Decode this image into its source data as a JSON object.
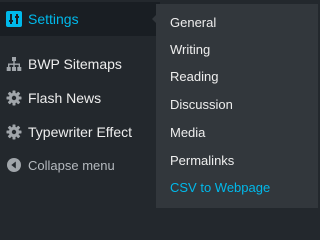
{
  "menu": {
    "settings": "Settings",
    "bwp_sitemaps": "BWP Sitemaps",
    "flash_news": "Flash News",
    "typewriter_effect": "Typewriter Effect",
    "collapse": "Collapse menu"
  },
  "submenu": [
    "General",
    "Writing",
    "Reading",
    "Discussion",
    "Media",
    "Permalinks",
    "CSV to Webpage"
  ],
  "colors": {
    "accent": "#00b9eb",
    "sidebar_bg": "#23282d",
    "flyout_bg": "#32373c"
  },
  "icons": {
    "settings": "settings-sliders-icon",
    "bwp_sitemaps": "sitemap-icon",
    "flash_news": "gear-icon",
    "typewriter_effect": "gear-icon",
    "collapse": "collapse-arrow-icon"
  }
}
